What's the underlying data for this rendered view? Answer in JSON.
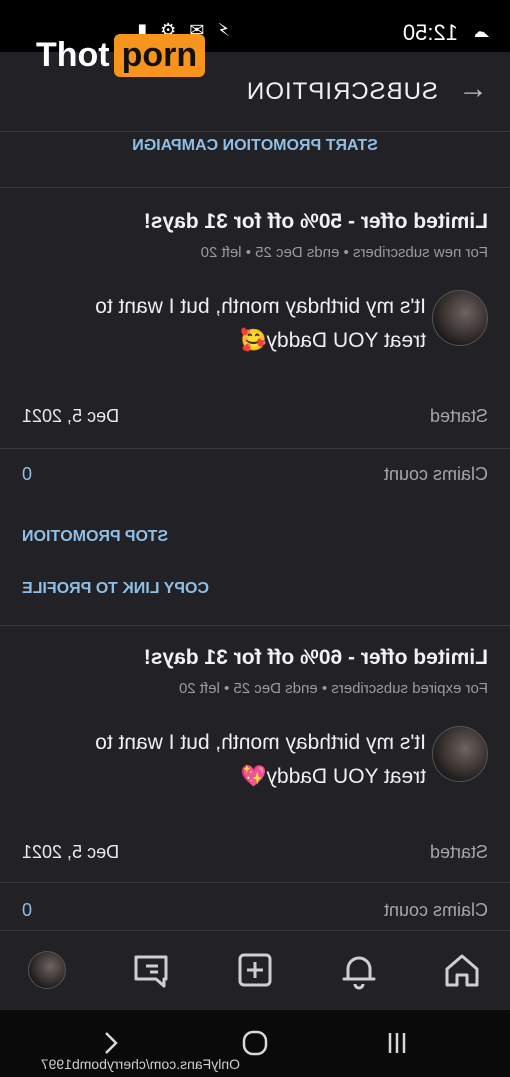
{
  "status_bar": {
    "time": "12:50",
    "right_icons": "⚡ ✉ ⚙ ▮"
  },
  "header": {
    "title": "SUBSCRIPTION"
  },
  "campaign": {
    "label": "START PROMOTION CAMPAIGN"
  },
  "offers": [
    {
      "title": "Limited offer - 50% off for 31 days!",
      "audience": "For new subscribers",
      "ends": "ends Dec 25",
      "left": "left 20",
      "message": "It's my birthday month, but I want to treat YOU Daddy🥰",
      "started_label": "Started",
      "started_value": "Dec 5, 2021",
      "claims_label": "Claims count",
      "claims_value": "0",
      "stop_label": "STOP PROMOTION",
      "copy_label": "COPY LINK TO PROFILE"
    },
    {
      "title": "Limited offer - 60% off for 31 days!",
      "audience": "For expired subscribers",
      "ends": "ends Dec 25",
      "left": "left 20",
      "message": "It's my birthday month, but I want to treat YOU Daddy💖",
      "started_label": "Started",
      "started_value": "Dec 5, 2021",
      "claims_label": "Claims count",
      "claims_value": "0"
    }
  ],
  "bottom_nav": {
    "items": [
      "home-icon",
      "bell-icon",
      "add-icon",
      "messages-icon",
      "profile-avatar"
    ]
  },
  "system_nav": {
    "items": [
      "recents-icon",
      "home-circle-icon",
      "back-chevron-icon"
    ]
  },
  "watermark": {
    "logo_part1": "Thot",
    "logo_part2": "porn",
    "url": "OnlyFans.com/cherrybomb1997"
  },
  "colors": {
    "background": "#222226",
    "accent": "#8fbfe6",
    "logo_orange": "#f7941d"
  }
}
